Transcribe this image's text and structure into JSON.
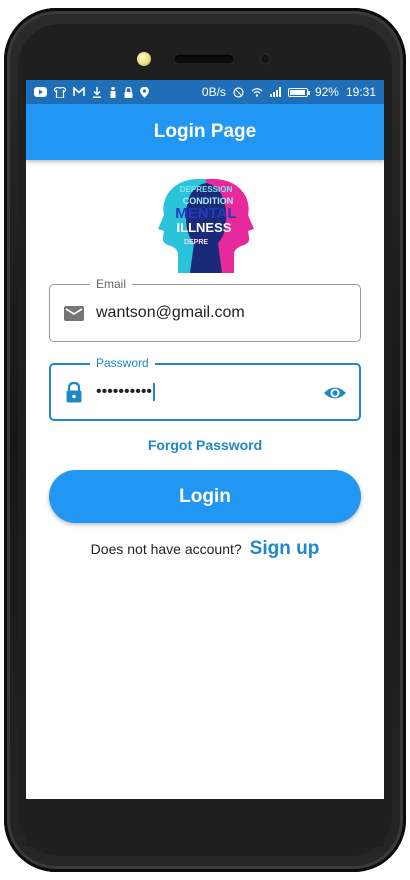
{
  "status_bar": {
    "network_speed": "0B/s",
    "battery_percent": "92%",
    "time": "19:31",
    "icons": [
      "youtube-icon",
      "shirt-icon",
      "gmail-icon",
      "download-icon",
      "figure-icon",
      "lock-icon",
      "location-icon",
      "mute-icon",
      "wifi-icon",
      "signal-icon",
      "battery-icon"
    ]
  },
  "app_bar": {
    "title": "Login Page"
  },
  "email_field": {
    "label": "Email",
    "value": "wantson@gmail.com"
  },
  "password_field": {
    "label": "Password",
    "value": "••••••••••"
  },
  "forgot_password": "Forgot Password",
  "login_button": "Login",
  "signup": {
    "prompt": "Does not have account?",
    "link": "Sign up"
  },
  "logo": {
    "words": [
      "DEPRESSION",
      "CONDITION",
      "MENTAL",
      "ILLNESS",
      "DEPRE"
    ]
  },
  "colors": {
    "primary": "#2196f3",
    "status_bar": "#1f6fb8",
    "accent_text": "#1e88c9",
    "logo_cyan": "#29c4d9",
    "logo_magenta": "#e8299b",
    "logo_navy": "#1b2a78"
  }
}
